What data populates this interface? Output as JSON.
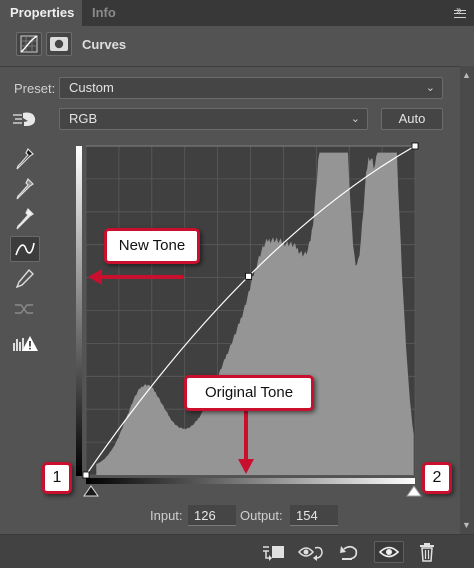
{
  "tabs": {
    "properties": "Properties",
    "info": "Info"
  },
  "panel_icons": [
    "collapse-icon",
    "panel-menu-icon"
  ],
  "header": {
    "title": "Curves",
    "icons": [
      "curves-adjustment-icon",
      "layer-mask-icon"
    ]
  },
  "preset": {
    "label": "Preset:",
    "value": "Custom"
  },
  "channel": {
    "value": "RGB"
  },
  "auto_button": "Auto",
  "tools": [
    "on-image-adjust-icon",
    "black-point-eyedropper-icon",
    "gray-point-eyedropper-icon",
    "white-point-eyedropper-icon",
    "curve-point-edit-icon",
    "pencil-draw-icon",
    "smooth-curve-icon",
    "clipping-warning-icon"
  ],
  "curve": {
    "points": [
      [
        0,
        0
      ],
      [
        126,
        154
      ],
      [
        255,
        255
      ]
    ]
  },
  "histogram_color": "#959595",
  "io": {
    "input_label": "Input:",
    "input_value": "126",
    "output_label": "Output:",
    "output_value": "154"
  },
  "footer_icons": [
    "clip-to-layer-icon",
    "view-previous-state-icon",
    "reset-icon",
    "visibility-eye-icon",
    "trash-icon"
  ],
  "annotations": {
    "new_tone": "New Tone",
    "original_tone": "Original Tone",
    "marker_1": "1",
    "marker_2": "2",
    "accent_color": "#c8102e"
  }
}
